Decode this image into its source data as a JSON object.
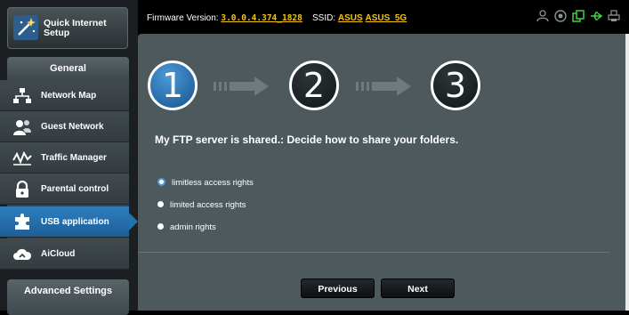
{
  "sidebar": {
    "quick_setup": "Quick Internet Setup",
    "general_header": "General",
    "items": [
      {
        "label": "Network Map",
        "icon": "network-map-icon"
      },
      {
        "label": "Guest Network",
        "icon": "guest-network-icon"
      },
      {
        "label": "Traffic Manager",
        "icon": "traffic-manager-icon"
      },
      {
        "label": "Parental control",
        "icon": "parental-control-icon"
      },
      {
        "label": "USB application",
        "icon": "usb-application-icon",
        "active": true
      },
      {
        "label": "AiCloud",
        "icon": "aicloud-icon"
      }
    ],
    "advanced_header": "Advanced Settings"
  },
  "topbar": {
    "firmware_label": "Firmware Version:",
    "firmware_value": "3.0.0.4.374_1828",
    "ssid_label": "SSID:",
    "ssid_1": "ASUS",
    "ssid_2": "ASUS_5G",
    "status_icons": [
      "user-icon",
      "globe-icon",
      "copy-icon",
      "usb-icon",
      "printer-icon"
    ]
  },
  "wizard": {
    "steps": [
      "1",
      "2",
      "3"
    ],
    "active_step": 1,
    "heading": "My FTP server is shared.: Decide how to share your folders.",
    "options": [
      {
        "label": "limitless access rights",
        "checked": true
      },
      {
        "label": "limited access rights",
        "checked": false
      },
      {
        "label": "admin rights",
        "checked": false
      }
    ],
    "previous_label": "Previous",
    "next_label": "Next"
  },
  "colors": {
    "accent_blue": "#2272ad",
    "panel": "#4d595d",
    "highlight_yellow": "#f2c40d",
    "status_green": "#3fd23f"
  }
}
